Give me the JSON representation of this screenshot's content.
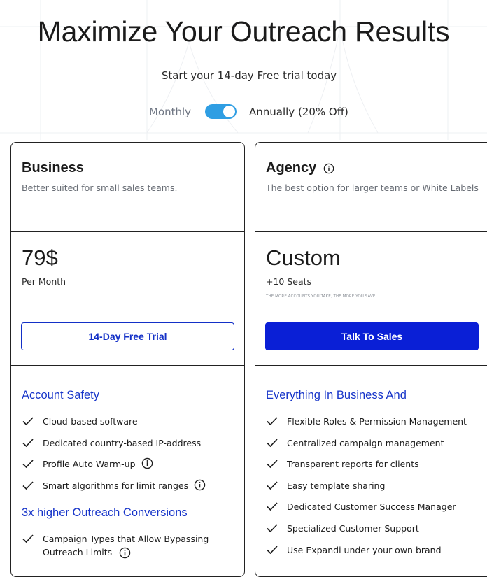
{
  "header": {
    "title": "Maximize Your Outreach Results",
    "subtitle": "Start your 14-day Free trial today"
  },
  "billing_toggle": {
    "left_label": "Monthly",
    "right_label": "Annually (20% Off)",
    "selected": "Annually (20% Off)"
  },
  "plans": [
    {
      "name": "Business",
      "description": "Better suited for small sales teams.",
      "price": "79$",
      "price_sub": "Per Month",
      "cta": "14-Day Free Trial",
      "sections": [
        {
          "title": "Account Safety",
          "features": [
            {
              "text": "Cloud-based software"
            },
            {
              "text": "Dedicated country-based IP-address"
            },
            {
              "text": "Profile Auto Warm-up",
              "info": true
            },
            {
              "text": "Smart algorithms for limit ranges",
              "info": true
            }
          ]
        },
        {
          "title": "3x higher Outreach Conversions",
          "features": [
            {
              "text": "Campaign Types that Allow Bypassing",
              "text2": "Outreach Limits",
              "info": true
            }
          ]
        }
      ]
    },
    {
      "name": "Agency",
      "description": "The best option for larger teams or White Labels",
      "price": "Custom",
      "price_sub": "+10 Seats",
      "price_note": "THE MORE ACCOUNTS YOU TAKE, THE MORE YOU SAVE",
      "cta": "Talk To Sales",
      "sections": [
        {
          "title": "Everything In Business And",
          "features": [
            {
              "text": "Flexible Roles & Permission Management"
            },
            {
              "text": "Centralized campaign management"
            },
            {
              "text": "Transparent reports for clients"
            },
            {
              "text": "Easy template sharing"
            },
            {
              "text": "Dedicated Customer Success Manager"
            },
            {
              "text": "Specialized Customer Support"
            },
            {
              "text": "Use Expandi under your own brand"
            }
          ]
        }
      ]
    }
  ],
  "icons": {
    "info": "info-circle-icon",
    "check": "check-icon"
  },
  "colors": {
    "accent_blue": "#0a1fd6",
    "section_blue": "#1634c9",
    "toggle_blue": "#2f9ee3"
  }
}
